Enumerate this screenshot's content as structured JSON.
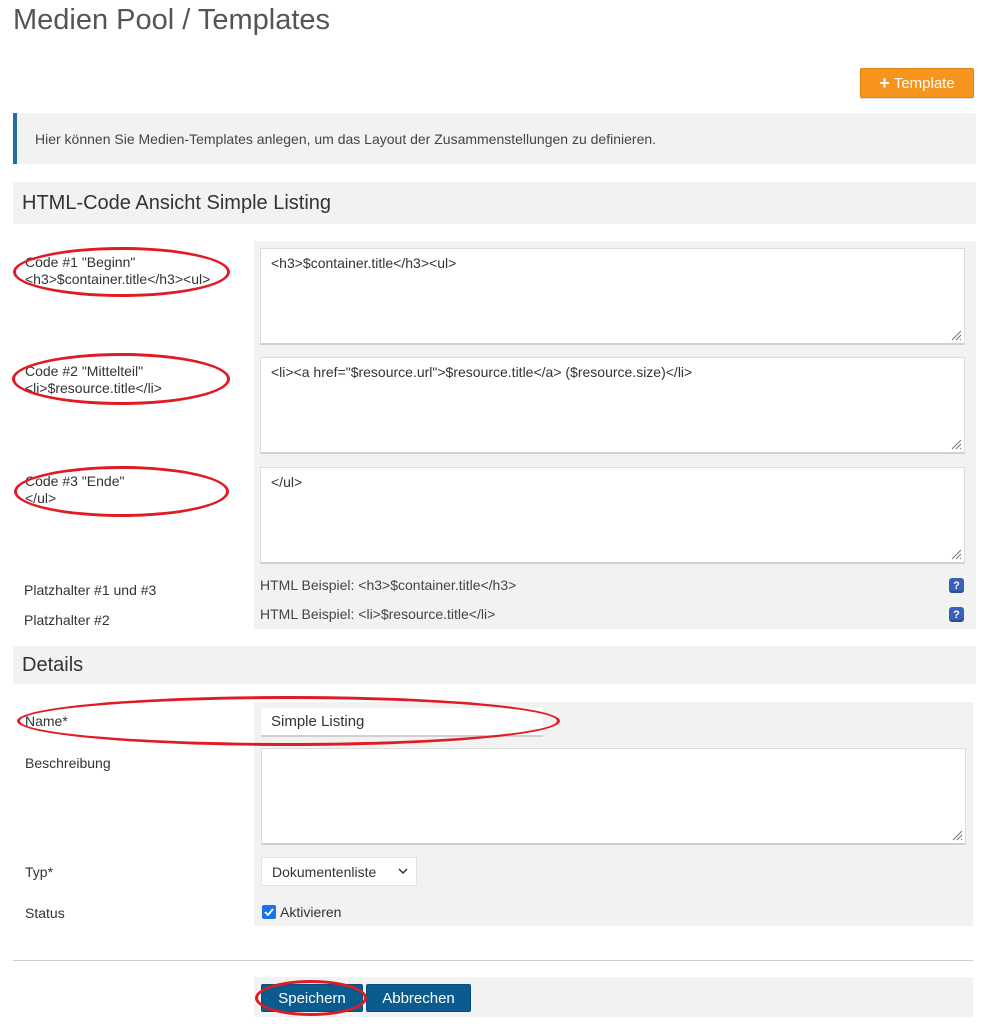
{
  "page": {
    "title": "Medien Pool / Templates"
  },
  "toolbar": {
    "add_label": "Template"
  },
  "info": {
    "text": "Hier können Sie Medien-Templates anlegen, um das Layout der Zusammenstellungen zu definieren."
  },
  "html_section": {
    "heading": "HTML-Code Ansicht Simple Listing",
    "fields": [
      {
        "label_line1": "Code #1 \"Beginn\"",
        "label_line2": "<h3>$container.title</h3><ul>",
        "value": "<h3>$container.title</h3><ul>"
      },
      {
        "label_line1": "Code #2 \"Mittelteil\"",
        "label_line2": "<li>$resource.title</li>",
        "value": "<li><a href=\"$resource.url\">$resource.title</a> ($resource.size)</li>"
      },
      {
        "label_line1": "Code #3 \"Ende\"",
        "label_line2": "</ul>",
        "value": "</ul>"
      }
    ],
    "placeholders": [
      {
        "label": "Platzhalter #1 und #3",
        "hint": "HTML Beispiel: <h3>$container.title</h3>"
      },
      {
        "label": "Platzhalter #2",
        "hint": "HTML Beispiel: <li>$resource.title</li>"
      }
    ],
    "help_glyph": "?"
  },
  "details": {
    "heading": "Details",
    "name_label": "Name*",
    "name_value": "Simple Listing",
    "description_label": "Beschreibung",
    "description_value": "",
    "type_label": "Typ*",
    "type_value": "Dokumentenliste",
    "status_label": "Status",
    "status_checkbox_label": "Aktivieren",
    "status_checked": true
  },
  "actions": {
    "save_label": "Speichern",
    "cancel_label": "Abbrechen"
  },
  "colors": {
    "accent_orange": "#f7941d",
    "primary_blue": "#0b5c8e",
    "annotation_red": "#e01b24"
  }
}
